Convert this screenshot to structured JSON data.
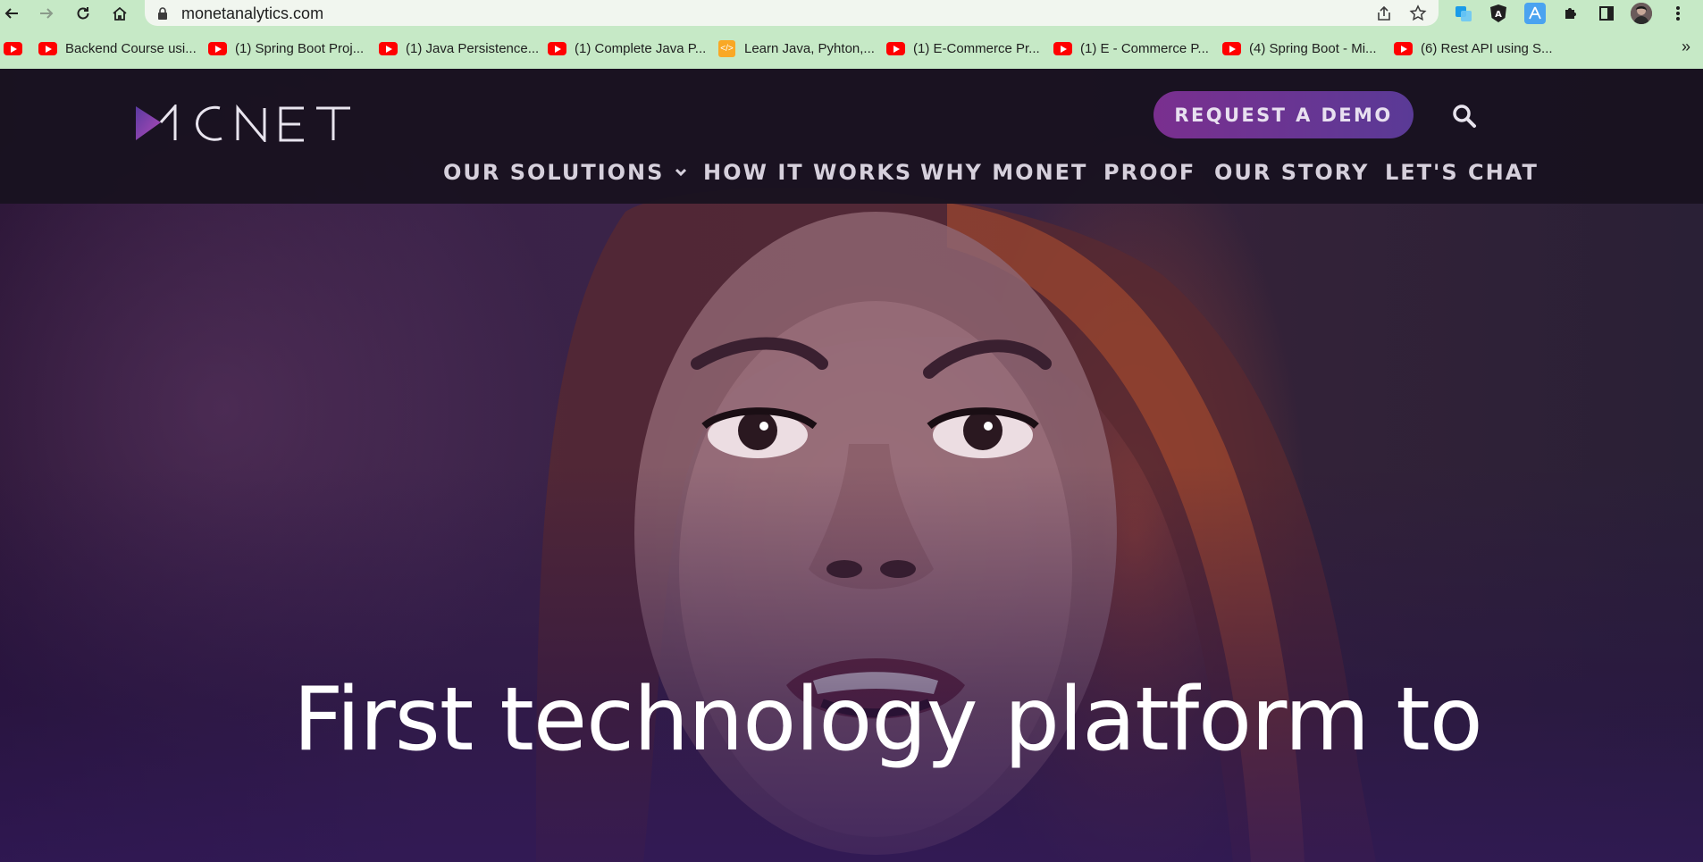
{
  "browser": {
    "url": "monetanalytics.com",
    "bookmarks": [
      {
        "label": "",
        "icon": "youtube-icon"
      },
      {
        "label": "Backend Course usi...",
        "icon": "youtube-icon"
      },
      {
        "label": "(1) Spring Boot Proj...",
        "icon": "youtube-icon"
      },
      {
        "label": "(1) Java Persistence...",
        "icon": "youtube-icon"
      },
      {
        "label": "(1) Complete Java P...",
        "icon": "youtube-icon"
      },
      {
        "label": "Learn Java, Pyhton,...",
        "icon": "code-icon"
      },
      {
        "label": "(1) E-Commerce Pr...",
        "icon": "youtube-icon"
      },
      {
        "label": "(1) E - Commerce P...",
        "icon": "youtube-icon"
      },
      {
        "label": "(4) Spring Boot - Mi...",
        "icon": "youtube-icon"
      },
      {
        "label": "(6) Rest API using S...",
        "icon": "youtube-icon"
      }
    ],
    "more": "»"
  },
  "site": {
    "logo_text": "MONET",
    "demo_label": "REQUEST A DEMO",
    "nav": [
      {
        "label": "OUR SOLUTIONS",
        "has_dropdown": true
      },
      {
        "label": "HOW IT WORKS"
      },
      {
        "label": "WHY MONET"
      },
      {
        "label": "PROOF"
      },
      {
        "label": "OUR STORY"
      },
      {
        "label": "LET'S CHAT"
      }
    ],
    "headline": "First technology platform to"
  },
  "colors": {
    "chrome": "#c6e9c6",
    "header_bg": "#18121f",
    "demo_gradient_start": "#7a2f8f",
    "demo_gradient_end": "#5a3a96"
  }
}
